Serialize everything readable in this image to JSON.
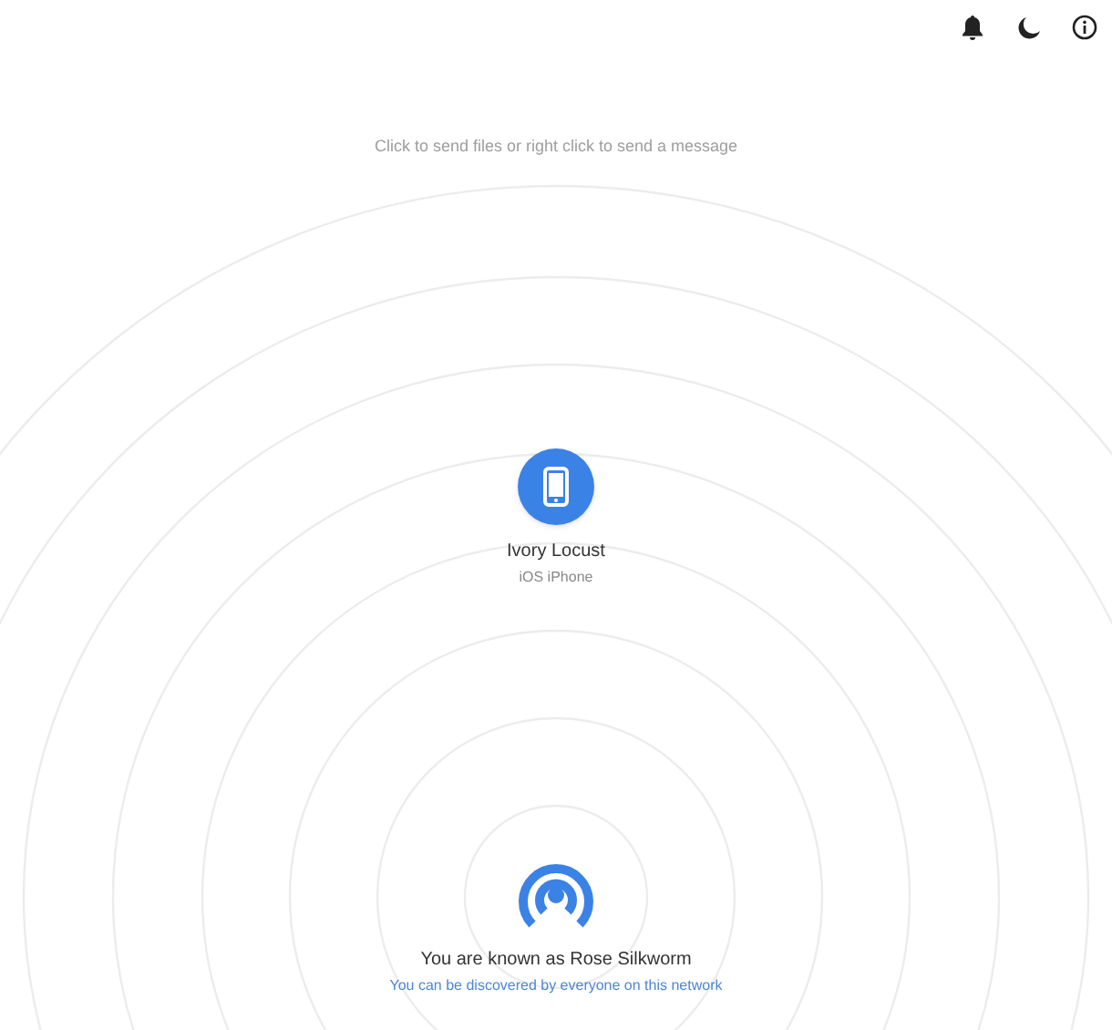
{
  "toolbar": {
    "buttons": [
      {
        "kind": "notifications"
      },
      {
        "kind": "theme"
      },
      {
        "kind": "about"
      }
    ]
  },
  "hint": "Click to send files or right click to send a message",
  "peers": [
    {
      "name": "Ivory Locust",
      "device": "iOS iPhone",
      "kind": "mobile"
    }
  ],
  "footer": {
    "display_name": "You are known as Rose Silkworm",
    "discovery": "You can be discovered by everyone on this network"
  }
}
